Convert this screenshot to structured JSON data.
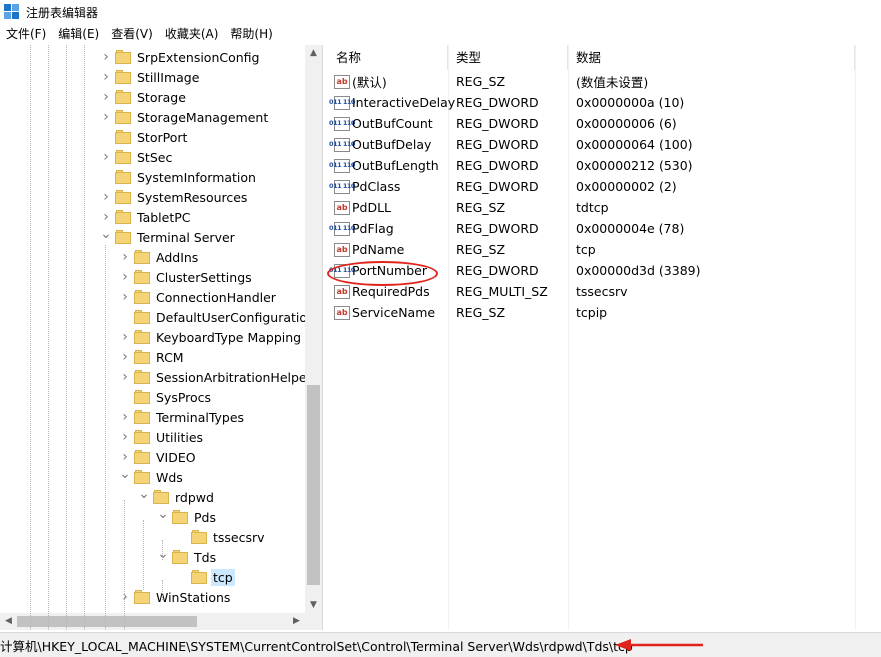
{
  "window": {
    "title": "注册表编辑器"
  },
  "menu": [
    "文件(F)",
    "编辑(E)",
    "查看(V)",
    "收藏夹(A)",
    "帮助(H)"
  ],
  "tree": [
    {
      "label": "SrpExtensionConfig",
      "level": 1,
      "expander": "collapsed-empty"
    },
    {
      "label": "StillImage",
      "level": 1,
      "expander": "collapsed"
    },
    {
      "label": "Storage",
      "level": 1,
      "expander": "collapsed"
    },
    {
      "label": "StorageManagement",
      "level": 1,
      "expander": "collapsed"
    },
    {
      "label": "StorPort",
      "level": 1,
      "expander": "none"
    },
    {
      "label": "StSec",
      "level": 1,
      "expander": "collapsed"
    },
    {
      "label": "SystemInformation",
      "level": 1,
      "expander": "none"
    },
    {
      "label": "SystemResources",
      "level": 1,
      "expander": "collapsed"
    },
    {
      "label": "TabletPC",
      "level": 1,
      "expander": "collapsed"
    },
    {
      "label": "Terminal Server",
      "level": 1,
      "expander": "expanded"
    },
    {
      "label": "AddIns",
      "level": 2,
      "expander": "collapsed"
    },
    {
      "label": "ClusterSettings",
      "level": 2,
      "expander": "collapsed"
    },
    {
      "label": "ConnectionHandler",
      "level": 2,
      "expander": "collapsed"
    },
    {
      "label": "DefaultUserConfiguration",
      "level": 2,
      "expander": "none"
    },
    {
      "label": "KeyboardType Mapping",
      "level": 2,
      "expander": "collapsed"
    },
    {
      "label": "RCM",
      "level": 2,
      "expander": "collapsed"
    },
    {
      "label": "SessionArbitrationHelper",
      "level": 2,
      "expander": "collapsed"
    },
    {
      "label": "SysProcs",
      "level": 2,
      "expander": "none"
    },
    {
      "label": "TerminalTypes",
      "level": 2,
      "expander": "collapsed"
    },
    {
      "label": "Utilities",
      "level": 2,
      "expander": "collapsed"
    },
    {
      "label": "VIDEO",
      "level": 2,
      "expander": "collapsed"
    },
    {
      "label": "Wds",
      "level": 2,
      "expander": "expanded"
    },
    {
      "label": "rdpwd",
      "level": 3,
      "expander": "expanded"
    },
    {
      "label": "Pds",
      "level": 4,
      "expander": "expanded"
    },
    {
      "label": "tssecsrv",
      "level": 5,
      "expander": "none"
    },
    {
      "label": "Tds",
      "level": 4,
      "expander": "expanded"
    },
    {
      "label": "tcp",
      "level": 5,
      "expander": "none",
      "selected": true
    },
    {
      "label": "WinStations",
      "level": 2,
      "expander": "collapsed"
    }
  ],
  "list": {
    "headers": {
      "name": "名称",
      "type": "类型",
      "data": "数据"
    },
    "rows": [
      {
        "name": "(默认)",
        "type": "REG_SZ",
        "data": "(数值未设置)",
        "icon": "sz"
      },
      {
        "name": "InteractiveDelay",
        "type": "REG_DWORD",
        "data": "0x0000000a (10)",
        "icon": "bin"
      },
      {
        "name": "OutBufCount",
        "type": "REG_DWORD",
        "data": "0x00000006 (6)",
        "icon": "bin"
      },
      {
        "name": "OutBufDelay",
        "type": "REG_DWORD",
        "data": "0x00000064 (100)",
        "icon": "bin"
      },
      {
        "name": "OutBufLength",
        "type": "REG_DWORD",
        "data": "0x00000212 (530)",
        "icon": "bin"
      },
      {
        "name": "PdClass",
        "type": "REG_DWORD",
        "data": "0x00000002 (2)",
        "icon": "bin"
      },
      {
        "name": "PdDLL",
        "type": "REG_SZ",
        "data": "tdtcp",
        "icon": "sz"
      },
      {
        "name": "PdFlag",
        "type": "REG_DWORD",
        "data": "0x0000004e (78)",
        "icon": "bin"
      },
      {
        "name": "PdName",
        "type": "REG_SZ",
        "data": "tcp",
        "icon": "sz"
      },
      {
        "name": "PortNumber",
        "type": "REG_DWORD",
        "data": "0x00000d3d (3389)",
        "icon": "bin",
        "highlighted": true
      },
      {
        "name": "RequiredPds",
        "type": "REG_MULTI_SZ",
        "data": "tssecsrv",
        "icon": "sz"
      },
      {
        "name": "ServiceName",
        "type": "REG_SZ",
        "data": "tcpip",
        "icon": "sz"
      }
    ]
  },
  "status": {
    "path": "计算机\\HKEY_LOCAL_MACHINE\\SYSTEM\\CurrentControlSet\\Control\\Terminal Server\\Wds\\rdpwd\\Tds\\tcp"
  },
  "colors": {
    "highlight": "#e0241c",
    "selection": "#cce8ff",
    "folder": "#f5d478"
  },
  "icons": {
    "sz": "ab",
    "bin": "011 110"
  }
}
